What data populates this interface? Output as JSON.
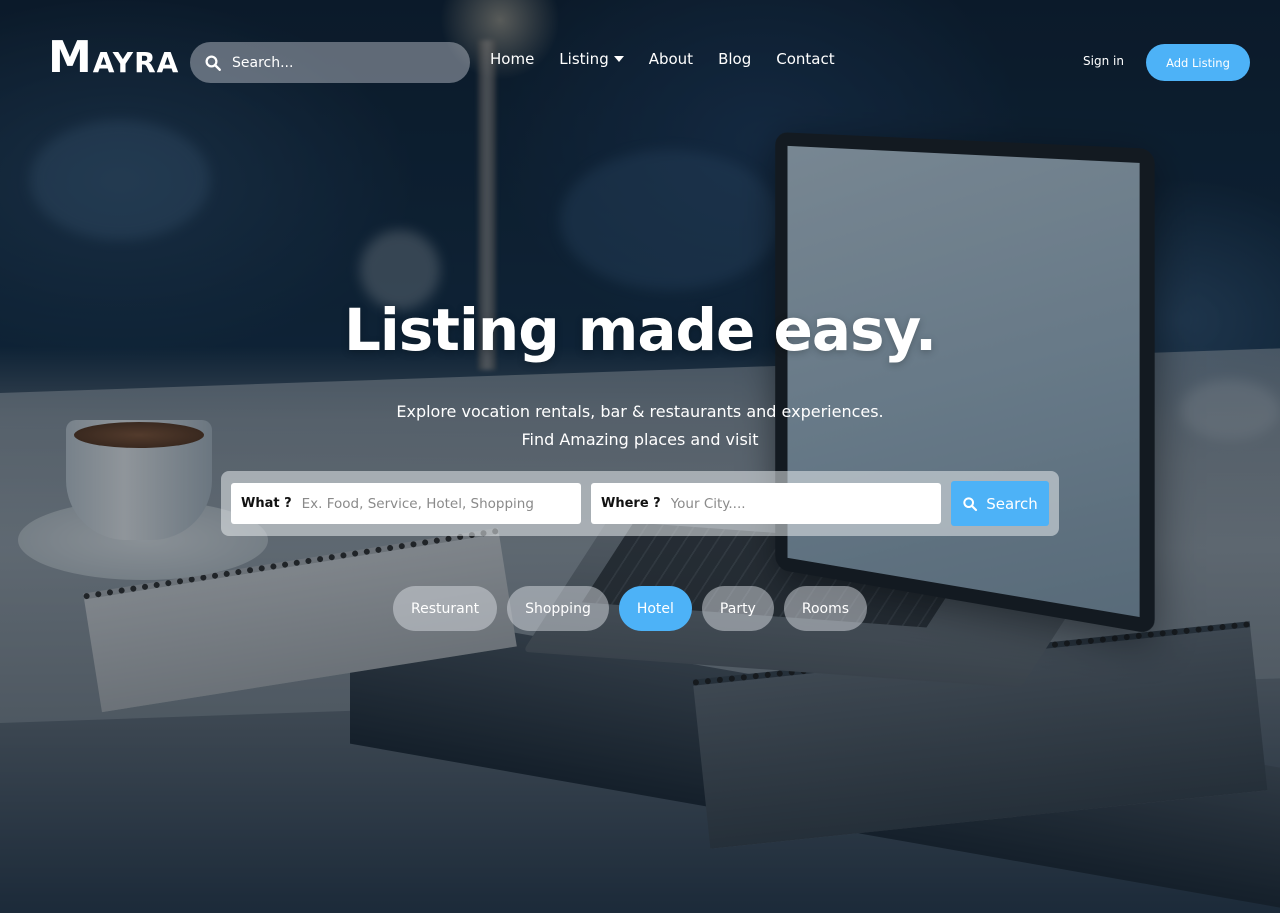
{
  "brand": {
    "logo_initial": "M",
    "logo_rest": "AYRA"
  },
  "header": {
    "search_placeholder": "Search...",
    "nav": [
      {
        "label": "Home"
      },
      {
        "label": "Listing",
        "has_dropdown": true
      },
      {
        "label": "About"
      },
      {
        "label": "Blog"
      },
      {
        "label": "Contact"
      }
    ],
    "sign_in_label": "Sign in",
    "add_listing_label": "Add Listing"
  },
  "hero": {
    "title": "Listing made easy.",
    "subtitle_line1": "Explore vocation rentals, bar & restaurants and experiences.",
    "subtitle_line2": "Find Amazing places and visit"
  },
  "search": {
    "what_label": "What ?",
    "what_placeholder": "Ex. Food, Service, Hotel, Shopping",
    "where_label": "Where ?",
    "where_placeholder": "Your City....",
    "button_label": "Search"
  },
  "categories": [
    {
      "label": "Resturant",
      "active": false
    },
    {
      "label": "Shopping",
      "active": false
    },
    {
      "label": "Hotel",
      "active": true
    },
    {
      "label": "Party",
      "active": false
    },
    {
      "label": "Rooms",
      "active": false
    }
  ],
  "colors": {
    "accent": "#4db2f7",
    "overlay": "#08101a",
    "text": "#ffffff"
  },
  "icons": {
    "search": "search-icon",
    "dropdown": "chevron-down-icon"
  }
}
